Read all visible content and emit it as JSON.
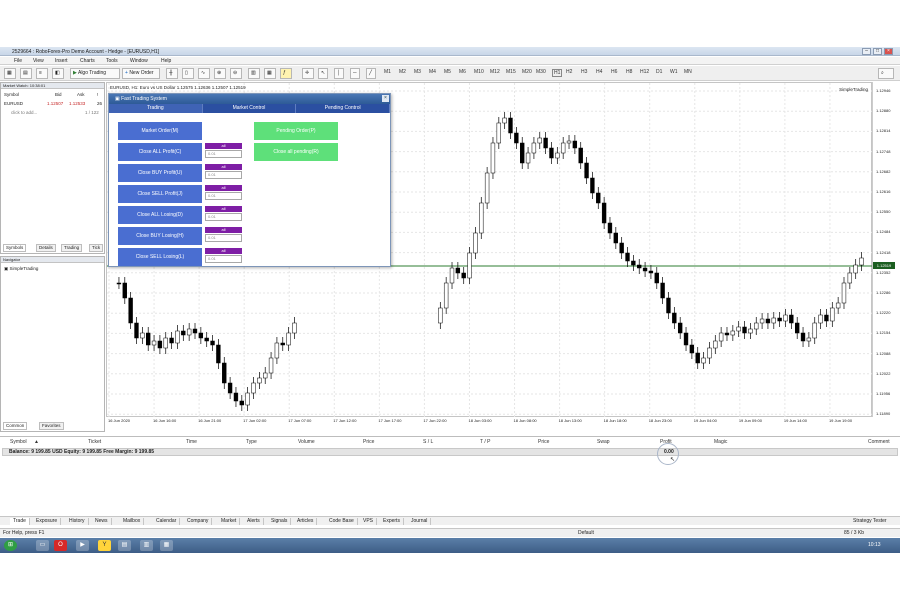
{
  "window": {
    "title": "2529664 : RoboForex-Pro Demo Account - Hedge - [EURUSD,H1]"
  },
  "menu": [
    "File",
    "View",
    "Insert",
    "Charts",
    "Tools",
    "Window",
    "Help"
  ],
  "toolbar": {
    "algo_label": "Algo Trading",
    "new_order_label": "New Order",
    "timeframes": [
      "M1",
      "M2",
      "M3",
      "M4",
      "M5",
      "M6",
      "M10",
      "M12",
      "M15",
      "M20",
      "M30",
      "H1",
      "H2",
      "H3",
      "H4",
      "H6",
      "H8",
      "H12",
      "D1",
      "W1",
      "MN"
    ]
  },
  "market_watch": {
    "title": "Market Watch: 10:38:01",
    "headers": [
      "Symbol",
      "Bid",
      "Ask",
      "!"
    ],
    "rows": [
      {
        "symbol": "EURUSD",
        "bid": "1.12507",
        "ask": "1.12533",
        "spread": "26"
      }
    ],
    "add_label": "click to add...",
    "count": "1 / 122",
    "tabs": [
      "Symbols",
      "Details",
      "Trading",
      "Tick"
    ]
  },
  "navigator": {
    "title": "Navigator",
    "item": "SimpleTrading",
    "tabs": [
      "Common",
      "Favorites"
    ]
  },
  "chart": {
    "header": "EURUSD, H1: Euro vs US Dollar 1.12575 1.12636 1.12507 1.12519",
    "label_tr": "SimpleTrading",
    "price_axis": [
      "1.12946",
      "1.12880",
      "1.12814",
      "1.12748",
      "1.12682",
      "1.12616",
      "1.12550",
      "1.12484",
      "1.12418",
      "1.12352",
      "1.12286",
      "1.12220",
      "1.12154",
      "1.12088",
      "1.12022",
      "1.11956",
      "1.11890"
    ],
    "current_price": "1.12519",
    "time_axis": [
      "16 Jun 2020",
      "16 Jun 16:00",
      "16 Jun 21:00",
      "17 Jun 02:00",
      "17 Jun 07:00",
      "17 Jun 12:00",
      "17 Jun 17:00",
      "17 Jun 22:00",
      "18 Jun 03:00",
      "18 Jun 08:00",
      "18 Jun 13:00",
      "18 Jun 18:00",
      "18 Jun 23:00",
      "19 Jun 04:00",
      "19 Jun 09:00",
      "19 Jun 14:00",
      "19 Jun 19:00"
    ]
  },
  "fts": {
    "title": "Fast Trading System",
    "tabs": [
      "Trading",
      "Market Control",
      "Pending Control"
    ],
    "buttons_left": [
      "Market Order(M)",
      "Close ALL Profit(C)",
      "Close BUY Profit(U)",
      "Close SELL Profit(J)",
      "Close ALL Losing(D)",
      "Close BUY Losing(H)",
      "Close SELL Losing(L)"
    ],
    "lot_label": "all",
    "lot_value": "0.01",
    "buttons_right": [
      "Pending Order(P)",
      "Close all pending(R)"
    ]
  },
  "terminal": {
    "headers": [
      "Symbol",
      "Ticket",
      "Time",
      "Type",
      "Volume",
      "Price",
      "S / L",
      "T / P",
      "Price",
      "Swap",
      "Profit",
      "Magic",
      "Comment"
    ],
    "balance": "Balance: 9 199.85 USD  Equity: 9 199.85  Free Margin: 9 199.85",
    "profit": "0.00",
    "tabs": [
      "Trade",
      "Exposure",
      "History",
      "News",
      "Mailbox",
      "Calendar",
      "Company",
      "Market",
      "Alerts",
      "Signals",
      "Articles",
      "Code Base",
      "VPS",
      "Experts",
      "Journal"
    ],
    "strategy_tester": "Strategy Tester"
  },
  "status": {
    "help": "For Help, press F1",
    "profile": "Default",
    "traffic": "85 / 3 Kb"
  },
  "taskbar": {
    "time": "10:13"
  },
  "colors": {
    "bull": "#000000",
    "bear": "#000000",
    "price_line": "#2e7d32",
    "ft_blue": "#4a6ed1",
    "ft_green": "#5ee07a",
    "ft_purple": "#7e1ea5"
  }
}
